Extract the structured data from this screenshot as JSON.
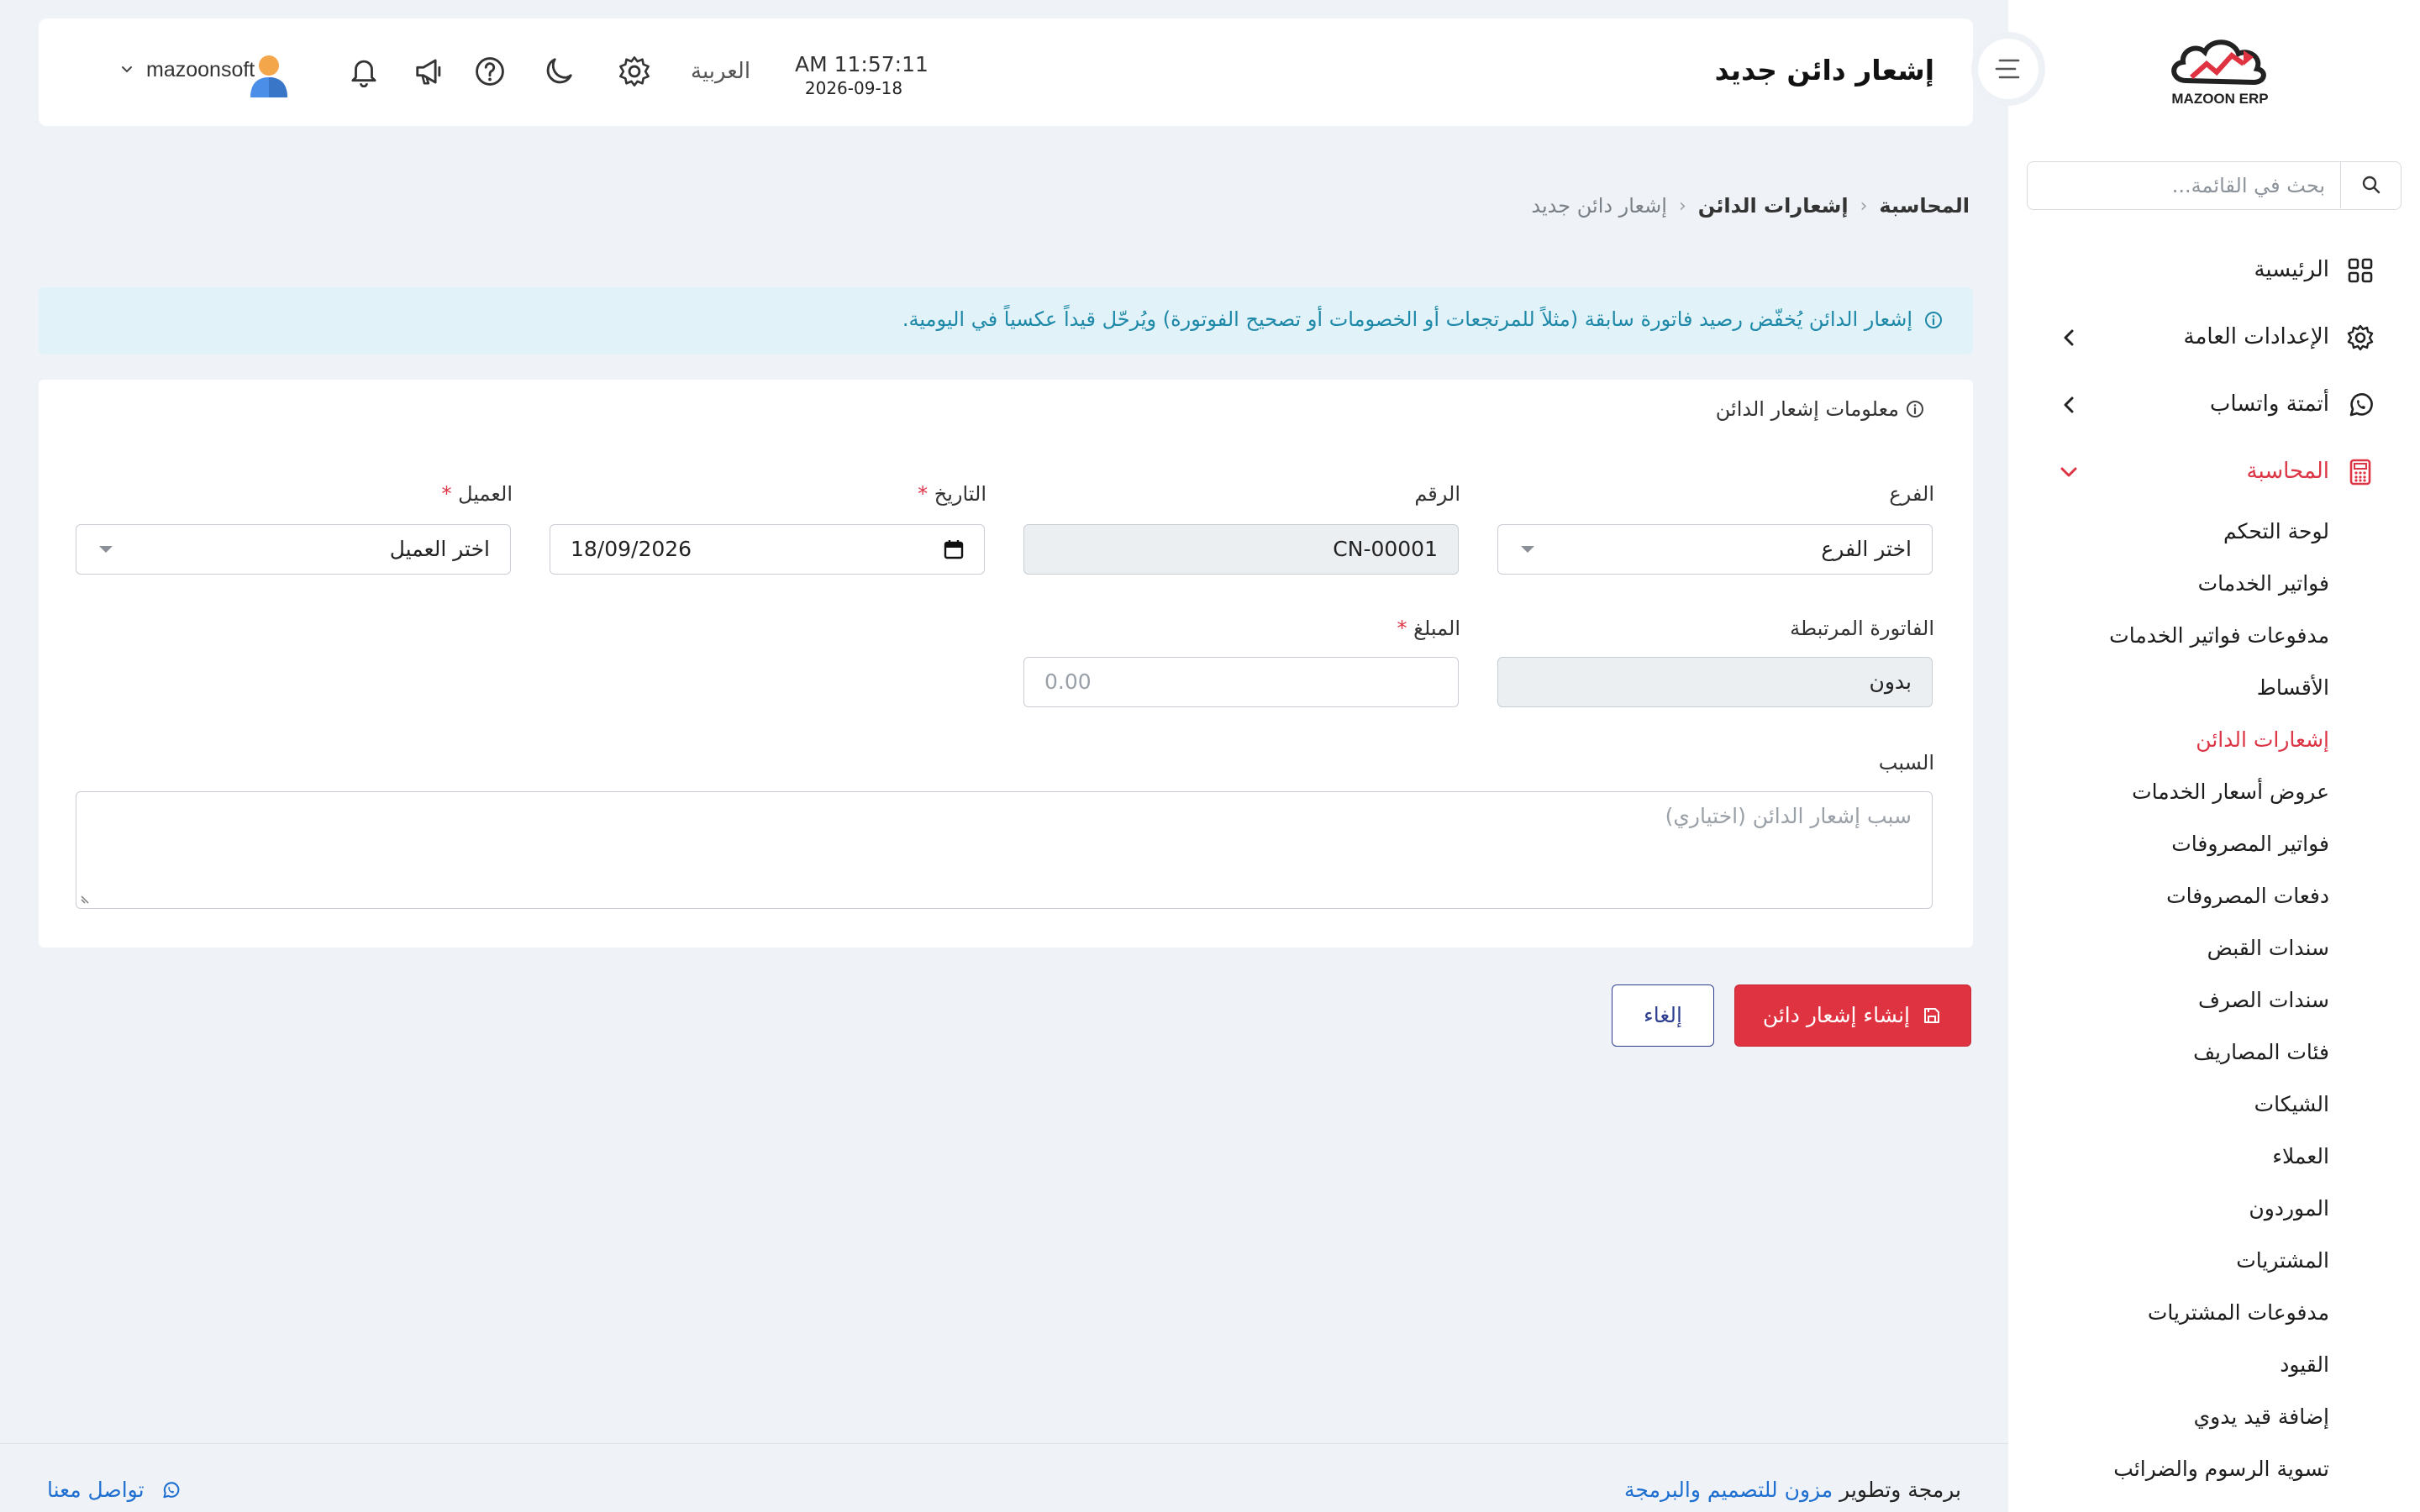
{
  "app": {
    "brand": "MAZOON ERP"
  },
  "sidebar": {
    "search_placeholder": "بحث في القائمة...",
    "main_items": [
      {
        "label": "الرئيسية",
        "icon": "grid-icon"
      },
      {
        "label": "الإعدادات العامة",
        "icon": "gear-icon"
      },
      {
        "label": "أتمتة واتساب",
        "icon": "whatsapp-icon"
      },
      {
        "label": "المحاسبة",
        "icon": "calculator-icon"
      }
    ],
    "sub_items": [
      "لوحة التحكم",
      "فواتير الخدمات",
      "مدفوعات فواتير الخدمات",
      "الأقساط",
      "إشعارات الدائن",
      "عروض أسعار الخدمات",
      "فواتير المصروفات",
      "دفعات المصروفات",
      "سندات القبض",
      "سندات الصرف",
      "فئات المصاريف",
      "الشيكات",
      "العملاء",
      "الموردون",
      "المشتريات",
      "مدفوعات المشتريات",
      "القيود",
      "إضافة قيد يدوي",
      "تسوية الرسوم والضرائب"
    ],
    "active_main": "المحاسبة",
    "active_sub": "إشعارات الدائن"
  },
  "header": {
    "title": "إشعار دائن جديد",
    "time": "AM 11:57:11",
    "date": "2026-09-18",
    "language": "العربية",
    "username": "mazoonsoft",
    "icons": [
      "gear-icon",
      "moon-icon",
      "help-icon",
      "megaphone-icon",
      "bell-icon"
    ]
  },
  "breadcrumb": {
    "items": [
      "المحاسبة",
      "إشعارات الدائن",
      "إشعار دائن جديد"
    ]
  },
  "alert": {
    "text": "إشعار الدائن يُخفّض رصيد فاتورة سابقة (مثلاً للمرتجعات أو الخصومات أو تصحيح الفوتورة) ويُرحّل قيداً عكسياً في اليومية."
  },
  "form": {
    "section_title": "معلومات إشعار الدائن",
    "branch": {
      "label": "الفرع",
      "value": "اختر الفرع"
    },
    "number": {
      "label": "الرقم",
      "value": "CN-00001"
    },
    "date": {
      "label": "التاريخ",
      "value": "18/09/2026",
      "required": true
    },
    "customer": {
      "label": "العميل",
      "value": "اختر العميل",
      "required": true
    },
    "linked_invoice": {
      "label": "الفاتورة المرتبطة",
      "value": "بدون"
    },
    "amount": {
      "label": "المبلغ",
      "placeholder": "0.00",
      "required": true
    },
    "reason": {
      "label": "السبب",
      "placeholder": "سبب إشعار الدائن (اختياري)"
    },
    "required_mark": "*"
  },
  "actions": {
    "create": "إنشاء إشعار دائن",
    "cancel": "إلغاء"
  },
  "footer": {
    "credit_prefix": "برمجة وتطوير",
    "credit_link": "مزون للتصميم والبرمجة",
    "contact": "تواصل معنا"
  },
  "colors": {
    "accent": "#dc3545",
    "primary_button": "#e03341",
    "cancel_border": "#2f3f8f",
    "info_bg": "#e1f3f8",
    "info_text": "#1e88a8",
    "link": "#1e6fd0",
    "page_bg": "#eff3f7"
  }
}
